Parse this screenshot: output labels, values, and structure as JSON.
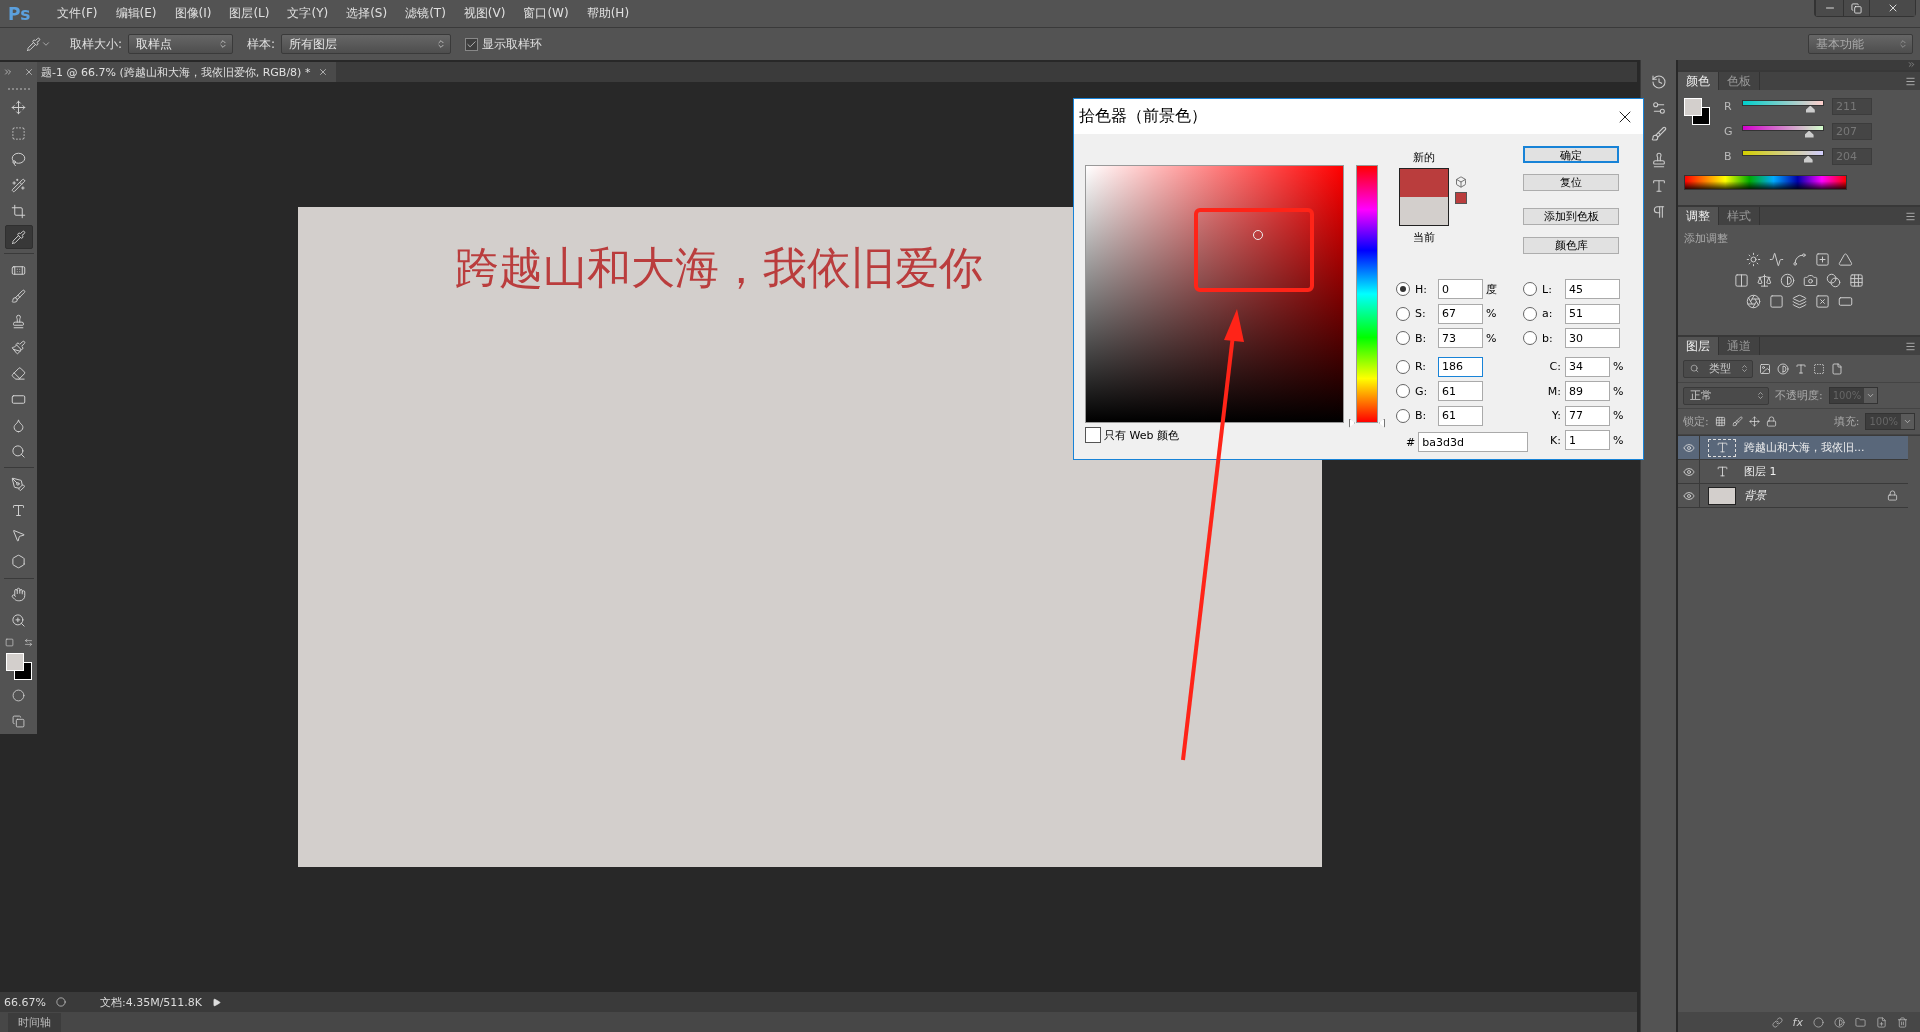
{
  "menu_bar": {
    "logo": "Ps",
    "items": [
      "文件(F)",
      "编辑(E)",
      "图像(I)",
      "图层(L)",
      "文字(Y)",
      "选择(S)",
      "滤镜(T)",
      "视图(V)",
      "窗口(W)",
      "帮助(H)"
    ]
  },
  "options_bar": {
    "sample_size_label": "取样大小:",
    "sample_size": "取样点",
    "sample_label": "样本:",
    "sample": "所有图层",
    "show_ring": {
      "label": "显示取样环",
      "checked": true
    },
    "workspace": "基本功能"
  },
  "document_tab": {
    "title": "题-1 @ 66.7% (跨越山和大海，我依旧爱你, RGB/8) *"
  },
  "tool_groups": [
    [
      {
        "kind": "move",
        "selected": false
      },
      {
        "kind": "marquee",
        "selected": false
      },
      {
        "kind": "lasso",
        "selected": false
      },
      {
        "kind": "quick-select",
        "selected": false
      },
      {
        "kind": "crop",
        "selected": false
      },
      {
        "kind": "eyedropper",
        "selected": true
      }
    ],
    [
      {
        "kind": "healing",
        "selected": false
      },
      {
        "kind": "brush",
        "selected": false
      },
      {
        "kind": "stamp",
        "selected": false
      },
      {
        "kind": "history-brush",
        "selected": false
      },
      {
        "kind": "eraser",
        "selected": false
      },
      {
        "kind": "gradient",
        "selected": false
      },
      {
        "kind": "blur",
        "selected": false
      },
      {
        "kind": "dodge",
        "selected": false
      }
    ],
    [
      {
        "kind": "pen",
        "selected": false
      },
      {
        "kind": "type",
        "selected": false
      },
      {
        "kind": "path-select",
        "selected": false
      },
      {
        "kind": "shape",
        "selected": false
      }
    ],
    [
      {
        "kind": "hand",
        "selected": false
      },
      {
        "kind": "zoom",
        "selected": false
      }
    ]
  ],
  "canvas": {
    "text": "跨越山和大海，我依旧爱你"
  },
  "color_picker": {
    "title": "拾色器（前景色）",
    "new_label": "新的",
    "current_label": "当前",
    "buttons": [
      {
        "label": "确定",
        "default": true
      },
      {
        "label": "复位",
        "default": false
      },
      {
        "label": "添加到色板",
        "default": false
      },
      {
        "label": "颜色库",
        "default": false
      }
    ],
    "left_fields": [
      {
        "kind": "radio",
        "label": "H:",
        "value": "0",
        "unit": "度",
        "selected": true,
        "focused": false
      },
      {
        "kind": "radio",
        "label": "S:",
        "value": "67",
        "unit": "%",
        "selected": false,
        "focused": false
      },
      {
        "kind": "radio",
        "label": "B:",
        "value": "73",
        "unit": "%",
        "selected": false,
        "focused": false
      },
      {
        "kind": "radio",
        "label": "R:",
        "value": "186",
        "selected": false,
        "focused": true
      },
      {
        "kind": "radio",
        "label": "G:",
        "value": "61",
        "selected": false,
        "focused": false
      },
      {
        "kind": "radio",
        "label": "B:",
        "value": "61",
        "selected": false,
        "focused": false
      }
    ],
    "right_fields": [
      {
        "kind": "radio",
        "label": "L:",
        "value": "45",
        "selected": false
      },
      {
        "kind": "radio",
        "label": "a:",
        "value": "51",
        "selected": false
      },
      {
        "kind": "radio",
        "label": "b:",
        "value": "30",
        "selected": false
      },
      {
        "kind": "plain",
        "label": "C:",
        "value": "34",
        "unit": "%"
      },
      {
        "kind": "plain",
        "label": "M:",
        "value": "89",
        "unit": "%"
      },
      {
        "kind": "plain",
        "label": "Y:",
        "value": "77",
        "unit": "%"
      },
      {
        "kind": "plain",
        "label": "K:",
        "value": "1",
        "unit": "%"
      }
    ],
    "hue_slider": {
      "level": 0
    },
    "hex_label": "#",
    "hex": "ba3d3d",
    "web_only": {
      "label": "只有 Web 颜色",
      "checked": false
    }
  },
  "color_panel": {
    "tabs": [
      {
        "label": "颜色",
        "selected": true
      },
      {
        "label": "色板",
        "selected": false
      }
    ],
    "sliders": [
      {
        "label": "R",
        "value": "211",
        "level": 0.827
      },
      {
        "label": "G",
        "value": "207",
        "level": 0.812
      },
      {
        "label": "B",
        "value": "204",
        "level": 0.8
      }
    ]
  },
  "adjustments_panel": {
    "tabs": [
      {
        "label": "调整",
        "selected": true
      },
      {
        "label": "样式",
        "selected": false
      }
    ],
    "hint": "添加调整"
  },
  "layers_panel": {
    "tabs": [
      {
        "label": "图层",
        "selected": true
      },
      {
        "label": "通道",
        "selected": false
      }
    ],
    "filter": "类型",
    "blend_mode": "正常",
    "opacity_label": "不透明度:",
    "opacity": "100%",
    "lock_label": "锁定:",
    "fill_label": "填充:",
    "fill": "100%",
    "layers": [
      {
        "kind": "text",
        "name": "跨越山和大海，我依旧...",
        "selected": true,
        "locked": false
      },
      {
        "kind": "text",
        "name": "图层 1",
        "selected": false,
        "locked": false
      },
      {
        "kind": "image",
        "name": "背景",
        "selected": false,
        "locked": true
      }
    ],
    "fx_label": "fx"
  },
  "status_bar": {
    "zoom": "66.67%",
    "doc_info": "文档:4.35M/511.8K"
  },
  "timeline": {
    "label": "时间轴"
  }
}
